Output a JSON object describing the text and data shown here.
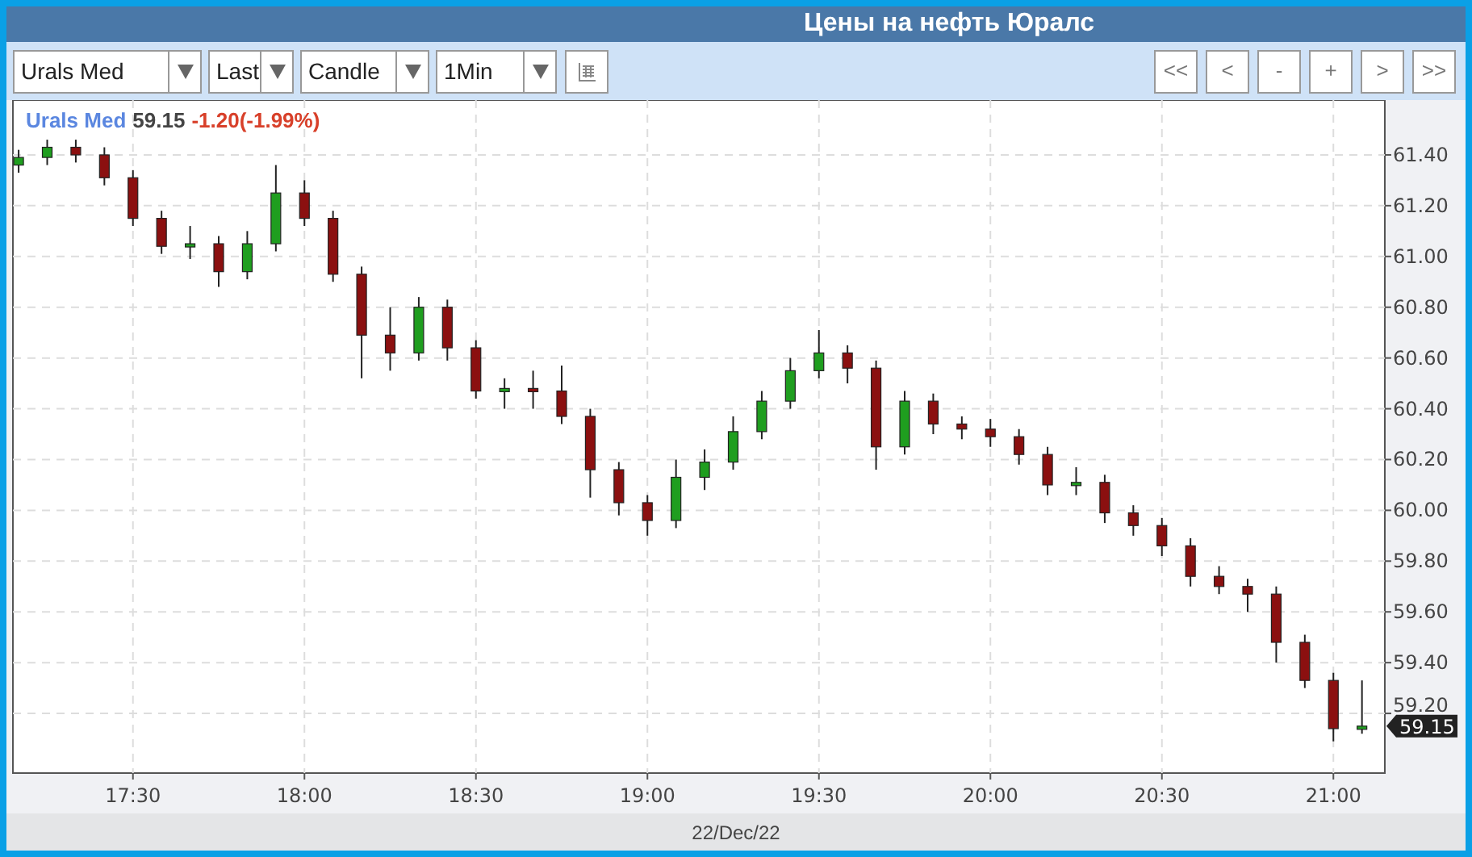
{
  "window": {
    "title": "Цены на нефть Юралс"
  },
  "toolbar": {
    "dropdowns": [
      {
        "value": "Urals Med"
      },
      {
        "value": "Last"
      },
      {
        "value": "Candle"
      },
      {
        "value": "1Min"
      }
    ],
    "nav_buttons": [
      "<<",
      "<",
      "-",
      "+",
      ">",
      ">>"
    ]
  },
  "chart": {
    "legend": {
      "symbol": "Urals Med",
      "price": "59.15",
      "change": "-1.20(-1.99%)"
    },
    "price_tag": "59.15",
    "date_label": "22/Dec/22",
    "chart_data": {
      "type": "candlestick",
      "categories": [
        null,
        null,
        null,
        null,
        "17:30",
        null,
        null,
        null,
        null,
        null,
        "18:00",
        null,
        null,
        null,
        null,
        null,
        "18:30",
        null,
        null,
        null,
        null,
        null,
        "19:00",
        null,
        null,
        null,
        null,
        null,
        "19:30",
        null,
        null,
        null,
        null,
        null,
        "20:00",
        null,
        null,
        null,
        null,
        null,
        "20:30",
        null,
        null,
        null,
        null,
        null,
        "21:00",
        null
      ],
      "ohlc": [
        [
          61.36,
          61.42,
          61.33,
          61.39
        ],
        [
          61.39,
          61.46,
          61.36,
          61.43
        ],
        [
          61.43,
          61.46,
          61.37,
          61.4
        ],
        [
          61.4,
          61.43,
          61.28,
          61.31
        ],
        [
          61.31,
          61.34,
          61.12,
          61.15
        ],
        [
          61.15,
          61.18,
          61.01,
          61.04
        ],
        [
          61.04,
          61.12,
          60.99,
          61.05
        ],
        [
          61.05,
          61.08,
          60.88,
          60.94
        ],
        [
          60.94,
          61.1,
          60.91,
          61.05
        ],
        [
          61.05,
          61.36,
          61.02,
          61.25
        ],
        [
          61.25,
          61.3,
          61.12,
          61.15
        ],
        [
          61.15,
          61.18,
          60.9,
          60.93
        ],
        [
          60.93,
          60.96,
          60.52,
          60.69
        ],
        [
          60.69,
          60.8,
          60.55,
          60.62
        ],
        [
          60.62,
          60.84,
          60.59,
          60.8
        ],
        [
          60.8,
          60.83,
          60.59,
          60.64
        ],
        [
          60.64,
          60.67,
          60.44,
          60.47
        ],
        [
          60.47,
          60.52,
          60.4,
          60.48
        ],
        [
          60.48,
          60.55,
          60.4,
          60.47
        ],
        [
          60.47,
          60.57,
          60.34,
          60.37
        ],
        [
          60.37,
          60.4,
          60.05,
          60.16
        ],
        [
          60.16,
          60.19,
          59.98,
          60.03
        ],
        [
          60.03,
          60.06,
          59.9,
          59.96
        ],
        [
          59.96,
          60.2,
          59.93,
          60.13
        ],
        [
          60.13,
          60.24,
          60.08,
          60.19
        ],
        [
          60.19,
          60.37,
          60.16,
          60.31
        ],
        [
          60.31,
          60.47,
          60.28,
          60.43
        ],
        [
          60.43,
          60.6,
          60.4,
          60.55
        ],
        [
          60.55,
          60.71,
          60.52,
          60.62
        ],
        [
          60.62,
          60.65,
          60.5,
          60.56
        ],
        [
          60.56,
          60.59,
          60.16,
          60.25
        ],
        [
          60.25,
          60.47,
          60.22,
          60.43
        ],
        [
          60.43,
          60.46,
          60.3,
          60.34
        ],
        [
          60.34,
          60.37,
          60.28,
          60.32
        ],
        [
          60.32,
          60.36,
          60.25,
          60.29
        ],
        [
          60.29,
          60.32,
          60.18,
          60.22
        ],
        [
          60.22,
          60.25,
          60.06,
          60.1
        ],
        [
          60.1,
          60.17,
          60.06,
          60.11
        ],
        [
          60.11,
          60.14,
          59.95,
          59.99
        ],
        [
          59.99,
          60.02,
          59.9,
          59.94
        ],
        [
          59.94,
          59.97,
          59.82,
          59.86
        ],
        [
          59.86,
          59.89,
          59.7,
          59.74
        ],
        [
          59.74,
          59.78,
          59.67,
          59.7
        ],
        [
          59.7,
          59.73,
          59.6,
          59.67
        ],
        [
          59.67,
          59.7,
          59.4,
          59.48
        ],
        [
          59.48,
          59.51,
          59.3,
          59.33
        ],
        [
          59.33,
          59.36,
          59.09,
          59.14
        ],
        [
          59.14,
          59.33,
          59.12,
          59.15
        ]
      ],
      "grid": true,
      "ylim": [
        58.965,
        61.616
      ],
      "yticks": [
        {
          "value": 59.2,
          "label": "59.20"
        },
        {
          "value": 59.4,
          "label": "59.40"
        },
        {
          "value": 59.6,
          "label": "59.60"
        },
        {
          "value": 59.8,
          "label": "59.80"
        },
        {
          "value": 60,
          "label": "60.00"
        },
        {
          "value": 60.2,
          "label": "60.20"
        },
        {
          "value": 60.4,
          "label": "60.40"
        },
        {
          "value": 60.6,
          "label": "60.60"
        },
        {
          "value": 60.8,
          "label": "60.80"
        },
        {
          "value": 61,
          "label": "61.00"
        },
        {
          "value": 61.2,
          "label": "61.20"
        },
        {
          "value": 61.4,
          "label": "61.40"
        }
      ]
    }
  }
}
